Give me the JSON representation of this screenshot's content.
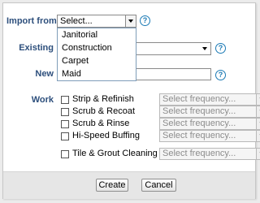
{
  "form": {
    "import_from": {
      "label": "Import from",
      "selected": "Select...",
      "options": [
        "Janitorial",
        "Construction",
        "Carpet",
        "Maid"
      ]
    },
    "existing": {
      "label": "Existing",
      "selected": ""
    },
    "new": {
      "label": "New",
      "value": ""
    },
    "work": {
      "label": "Work",
      "items": [
        {
          "label": "Strip & Refinish",
          "checked": false,
          "frequency": "Select frequency..."
        },
        {
          "label": "Scrub & Recoat",
          "checked": false,
          "frequency": "Select frequency..."
        },
        {
          "label": "Scrub & Rinse",
          "checked": false,
          "frequency": "Select frequency..."
        },
        {
          "label": "Hi-Speed Buffing",
          "checked": false,
          "frequency": "Select frequency..."
        },
        {
          "label": "Tile & Grout Cleaning",
          "checked": false,
          "frequency": "Select frequency..."
        }
      ]
    },
    "help_icon_glyph": "?"
  },
  "buttons": {
    "create": "Create",
    "cancel": "Cancel"
  },
  "colors": {
    "label": "#2d4f7c",
    "help_icon": "#1b7ab5",
    "footer_bg": "#e6e6e6"
  },
  "icons": [
    "help-icon",
    "chevron-down-icon"
  ]
}
